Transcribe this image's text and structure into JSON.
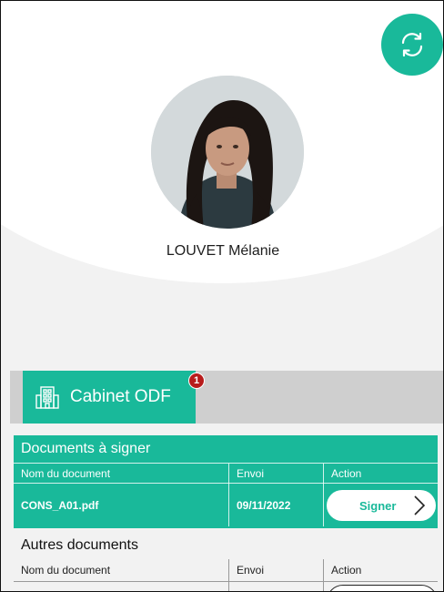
{
  "profile": {
    "name": "LOUVET Mélanie",
    "refresh_icon": "refresh-icon",
    "avatar_icon": "avatar-photo"
  },
  "cabinet": {
    "label": "Cabinet ODF",
    "badge_count": "1",
    "icon": "building-icon"
  },
  "documents_to_sign": {
    "title": "Documents à signer",
    "headers": [
      "Nom du document",
      "Envoi",
      "Action"
    ],
    "rows": [
      {
        "name": "CONS_A01.pdf",
        "date": "09/11/2022",
        "action": "Signer"
      }
    ]
  },
  "other_documents": {
    "title": "Autres documents",
    "headers": [
      "Nom du document",
      "Envoi",
      "Action"
    ]
  },
  "colors": {
    "accent": "#19b99a",
    "badge": "#b71c1c",
    "background": "#f2f2f2",
    "cabinet_bar": "#cfcfcf"
  }
}
